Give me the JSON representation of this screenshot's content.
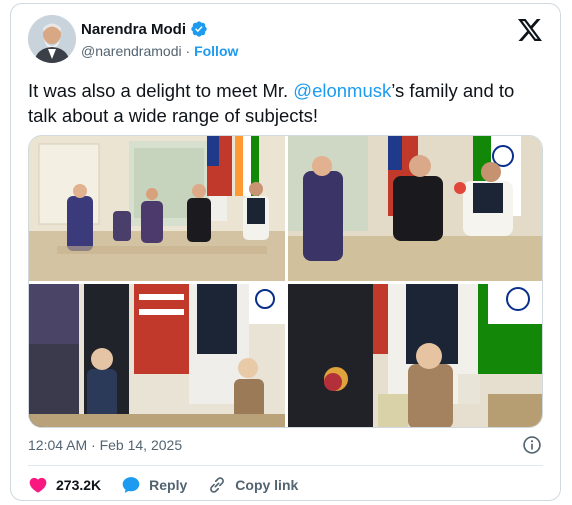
{
  "author": {
    "name": "Narendra Modi",
    "handle": "@narendramodi",
    "separator": "·",
    "follow_label": "Follow"
  },
  "tweet": {
    "text_before": "It was also a delight to meet Mr. ",
    "mention": "@elonmusk",
    "text_after": "’s family and to talk about a wide range of subjects!"
  },
  "meta": {
    "timestamp": "12:04 AM · Feb 14, 2025"
  },
  "actions": {
    "like_count": "273.2K",
    "reply_label": "Reply",
    "copy_label": "Copy link"
  },
  "icons": [
    "verified-badge-icon",
    "x-logo-icon",
    "info-icon",
    "heart-icon",
    "reply-icon",
    "link-icon"
  ],
  "colors": {
    "accent": "#1d9bf0",
    "heart": "#f91880",
    "text": "#0f1419",
    "muted": "#536471"
  }
}
